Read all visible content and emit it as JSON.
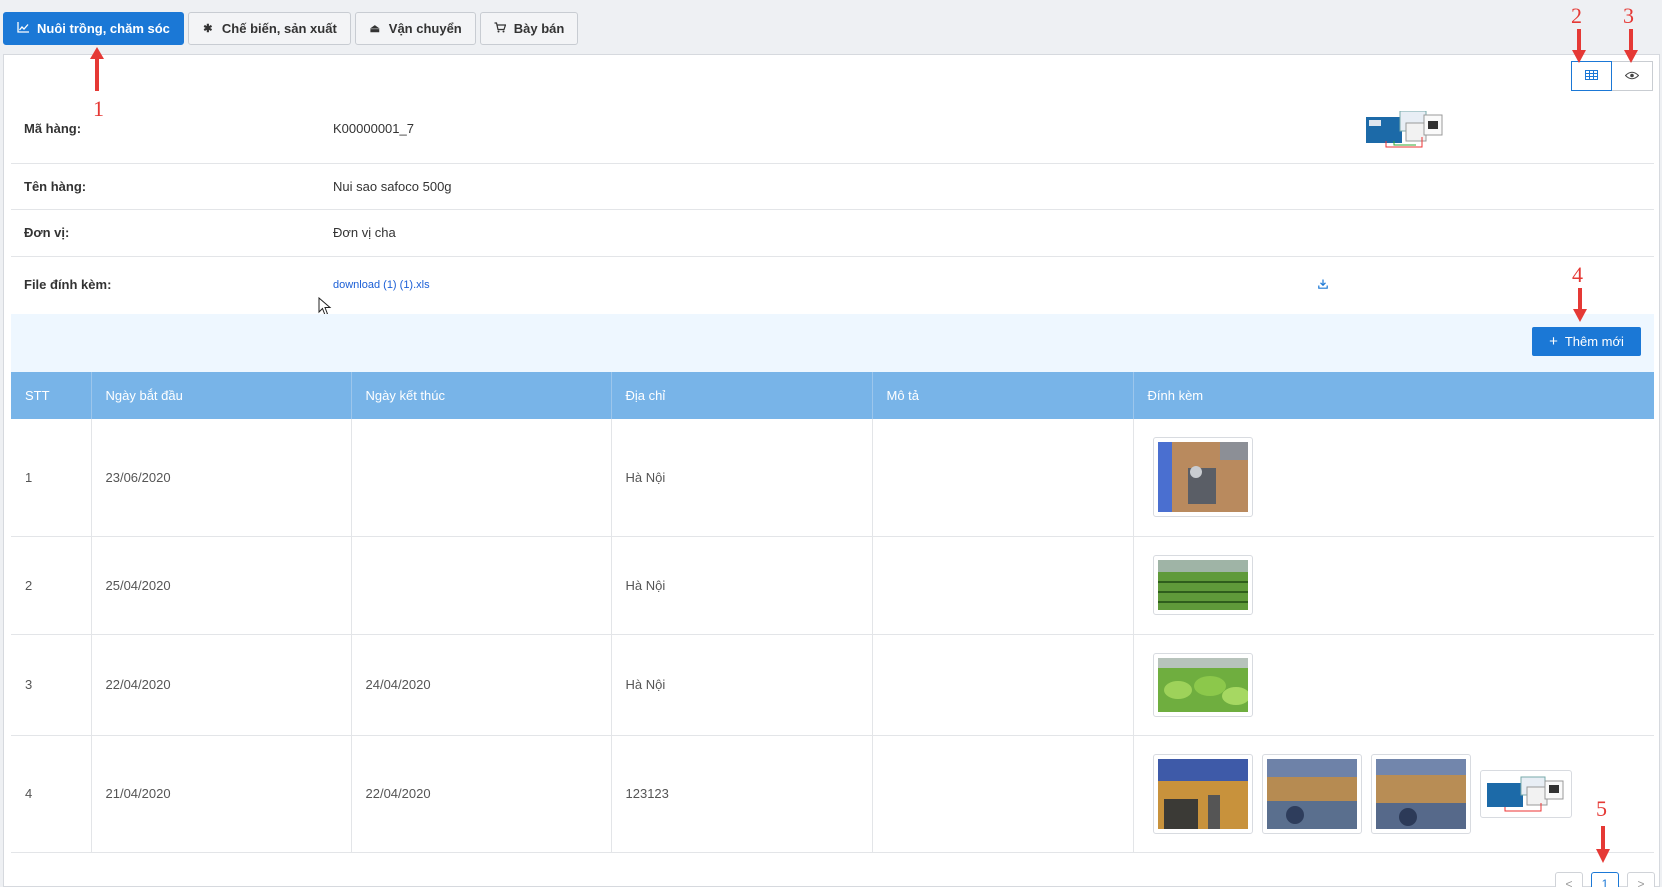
{
  "tabs": [
    {
      "label": "Nuôi trồng, chăm sóc",
      "icon": "chart-line-icon",
      "active": true
    },
    {
      "label": "Chế biến, sản xuất",
      "icon": "gear-icon",
      "active": false
    },
    {
      "label": "Vận chuyển",
      "icon": "eject-icon",
      "active": false
    },
    {
      "label": "Bày bán",
      "icon": "cart-icon",
      "active": false
    }
  ],
  "view_toggle": {
    "table_icon": "table-icon",
    "preview_icon": "eye-icon",
    "selected": "table"
  },
  "info": {
    "ma_hang": {
      "label": "Mã hàng:",
      "value": "K00000001_7"
    },
    "ten_hang": {
      "label": "Tên hàng:",
      "value": "Nui sao safoco 500g"
    },
    "don_vi": {
      "label": "Đơn vị:",
      "value": "Đơn vị cha"
    },
    "file": {
      "label": "File đính kèm:",
      "value": "download (1) (1).xls",
      "icon": "download-icon"
    }
  },
  "toolbar": {
    "add_label": "Thêm mới",
    "add_icon": "plus-icon"
  },
  "table": {
    "headers": [
      "STT",
      "Ngày bắt đầu",
      "Ngày kết thúc",
      "Địa chỉ",
      "Mô tả",
      "Đính kèm"
    ],
    "rows": [
      {
        "stt": "1",
        "start": "23/06/2020",
        "end": "",
        "address": "Hà Nội",
        "desc": "",
        "attachments": [
          "device-photo"
        ]
      },
      {
        "stt": "2",
        "start": "25/04/2020",
        "end": "",
        "address": "Hà Nội",
        "desc": "",
        "attachments": [
          "greenhouse-photo"
        ]
      },
      {
        "stt": "3",
        "start": "22/04/2020",
        "end": "24/04/2020",
        "address": "Hà Nội",
        "desc": "",
        "attachments": [
          "lettuce-photo"
        ]
      },
      {
        "stt": "4",
        "start": "21/04/2020",
        "end": "22/04/2020",
        "address": "123123",
        "desc": "",
        "attachments": [
          "ceiling-photo",
          "ceiling-photo",
          "ceiling-photo",
          "arduino-diagram"
        ]
      }
    ]
  },
  "pager": {
    "prev": "<",
    "current": "1",
    "next": ">"
  },
  "annotations": [
    "1",
    "2",
    "3",
    "4",
    "5"
  ],
  "colors": {
    "primary": "#1b78d6",
    "header": "#78b4e8",
    "annotation": "#e53935"
  }
}
